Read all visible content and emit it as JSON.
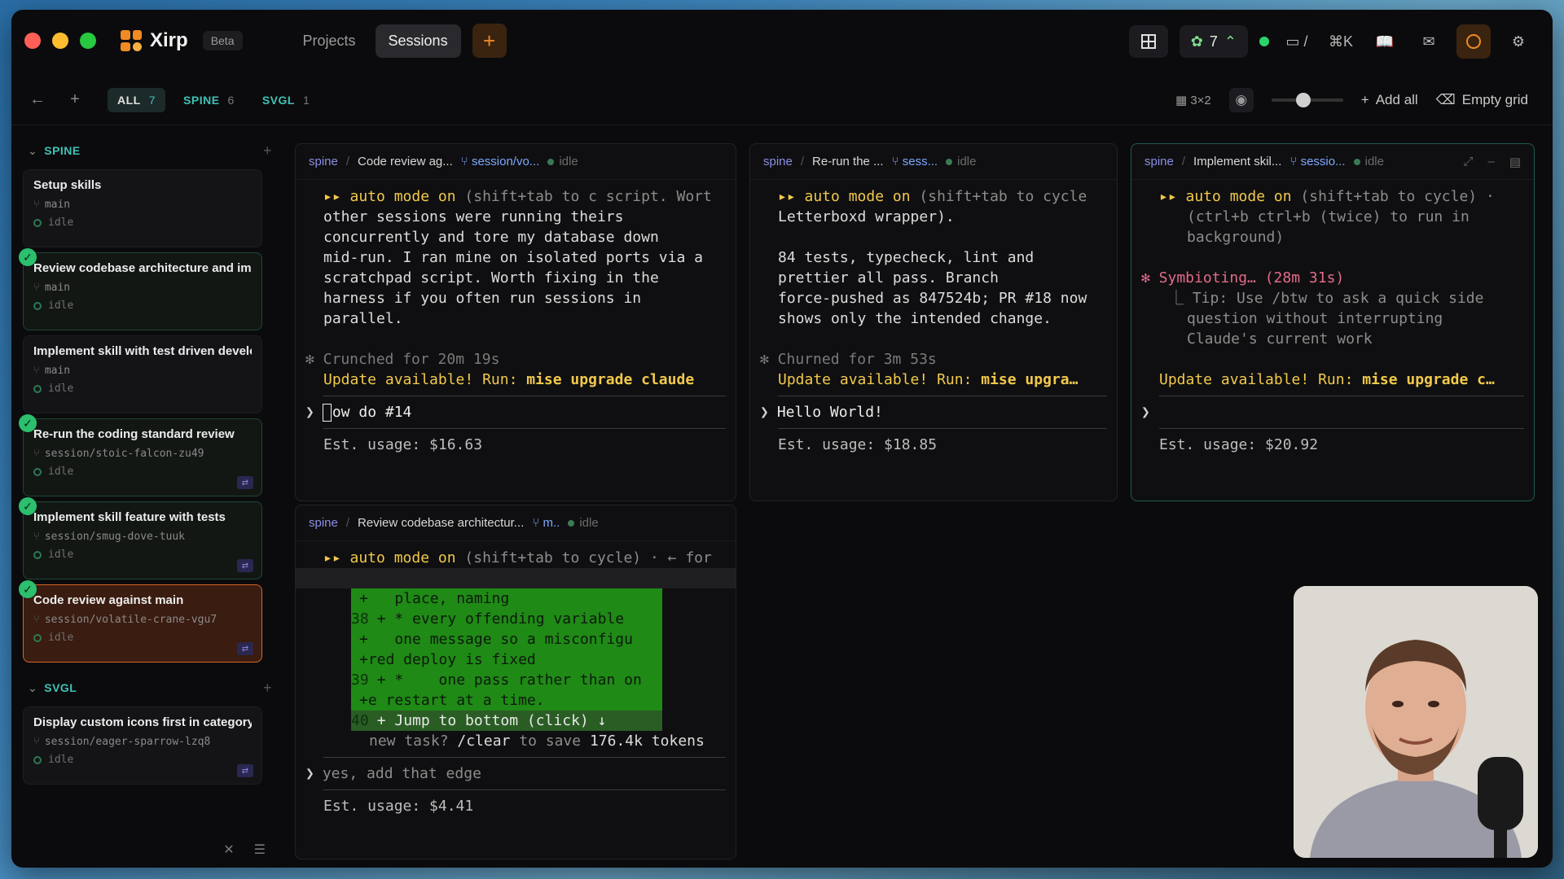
{
  "app": {
    "name": "Xirp",
    "badge": "Beta"
  },
  "nav": {
    "projects": "Projects",
    "sessions": "Sessions",
    "add": "+"
  },
  "topright": {
    "agents_count": "7",
    "shortcut": "⌘K",
    "slash": "/"
  },
  "filters": [
    {
      "label": "ALL",
      "count": "7"
    },
    {
      "label": "SPINE",
      "count": "6"
    },
    {
      "label": "SVGL",
      "count": "1"
    }
  ],
  "toolbar": {
    "layout": "3×2",
    "add_all": "Add all",
    "empty_grid": "Empty grid",
    "zoom_fraction": 0.45
  },
  "groups": {
    "spine": {
      "label": "SPINE"
    },
    "svgl": {
      "label": "SVGL"
    }
  },
  "sessions": [
    {
      "title": "Setup skills",
      "branch": "main",
      "status": "idle"
    },
    {
      "title": "Review codebase architecture and imp",
      "branch": "main",
      "status": "idle"
    },
    {
      "title": "Implement skill with test driven develo",
      "branch": "main",
      "status": "idle"
    },
    {
      "title": "Re-run the coding standard review",
      "branch": "session/stoic-falcon-zu49",
      "status": "idle"
    },
    {
      "title": "Implement skill feature with tests",
      "branch": "session/smug-dove-tuuk",
      "status": "idle"
    },
    {
      "title": "Code review against main",
      "branch": "session/volatile-crane-vgu7",
      "status": "idle"
    },
    {
      "title": "Display custom icons first in category",
      "branch": "session/eager-sparrow-lzq8",
      "status": "idle"
    }
  ],
  "panes": {
    "p1": {
      "project": "spine",
      "sep": "/",
      "title": "Code review ag...",
      "branch": "session/vo...",
      "status": "idle",
      "auto": "▸▸ auto mode on",
      "l1": " (shift+tab to c script. Wort",
      "lines": [
        "other sessions were running theirs",
        "concurrently and tore my database down",
        "mid-run. I ran mine on isolated ports via a",
        "scratchpad script. Worth fixing in the",
        "harness if you often run sessions in",
        "parallel."
      ],
      "crunch": "✻ Crunched for 20m 19s",
      "update_a": "Update available! Run: ",
      "update_b": "mise upgrade claude",
      "prompt": "ow do #14",
      "usage": "Est. usage: $16.63"
    },
    "p2": {
      "project": "spine",
      "sep": "/",
      "title": "Re-run the ...",
      "branch": "sess...",
      "status": "idle",
      "auto": "▸▸ auto mode on",
      "l1": " (shift+tab to cycle",
      "lines": [
        "Letterboxd wrapper).",
        "",
        "84 tests, typecheck, lint and",
        "prettier all pass. Branch",
        "force-pushed as 847524b; PR #18 now",
        "shows only the intended change."
      ],
      "crunch": "✻ Churned for 3m 53s",
      "update_a": "Update available! Run: ",
      "update_b": "mise upgra…",
      "prompt": "Hello World!",
      "usage": "Est. usage: $18.85"
    },
    "p3": {
      "project": "spine",
      "sep": "/",
      "title": "Implement skil...",
      "branch": "sessio...",
      "status": "idle",
      "auto": "▸▸ auto mode on",
      "l1": " (shift+tab to cycle) ·",
      "lines": [
        "(ctrl+b ctrl+b (twice) to run in",
        "background)"
      ],
      "symb": "✻ Symbioting… (28m 31s)",
      "tip": [
        "⎿ Tip: Use /btw to ask a quick side",
        "question without interrupting",
        "Claude's current work"
      ],
      "update_a": "Update available! Run: ",
      "update_b": "mise upgrade c…",
      "prompt": "",
      "usage": "Est. usage: $20.92"
    },
    "p4": {
      "project": "spine",
      "sep": "/",
      "title": "Review codebase architectur...",
      "branch": "m..",
      "status": "idle",
      "auto": "▸▸ auto mode on",
      "l1": " (shift+tab to cycle) · ← for",
      "diff": [
        {
          "num": "",
          "text": "+   place, naming"
        },
        {
          "num": "38",
          "text": "+ * every offending variable"
        },
        {
          "num": "",
          "text": "+   one message so a misconfigu"
        },
        {
          "num": "",
          "text": "+red deploy is fixed"
        },
        {
          "num": "39",
          "text": "+ *    one pass rather than on"
        },
        {
          "num": "",
          "text": "+e restart at a time."
        },
        {
          "num": "40",
          "text": "+ Jump to bottom (click) ↓"
        }
      ],
      "newtask_a": "new task? ",
      "newtask_b": "/clear",
      "newtask_c": " to save ",
      "newtask_d": "176.4k tokens",
      "prompt": "yes, add that edge",
      "usage": "Est. usage: $4.41"
    }
  }
}
